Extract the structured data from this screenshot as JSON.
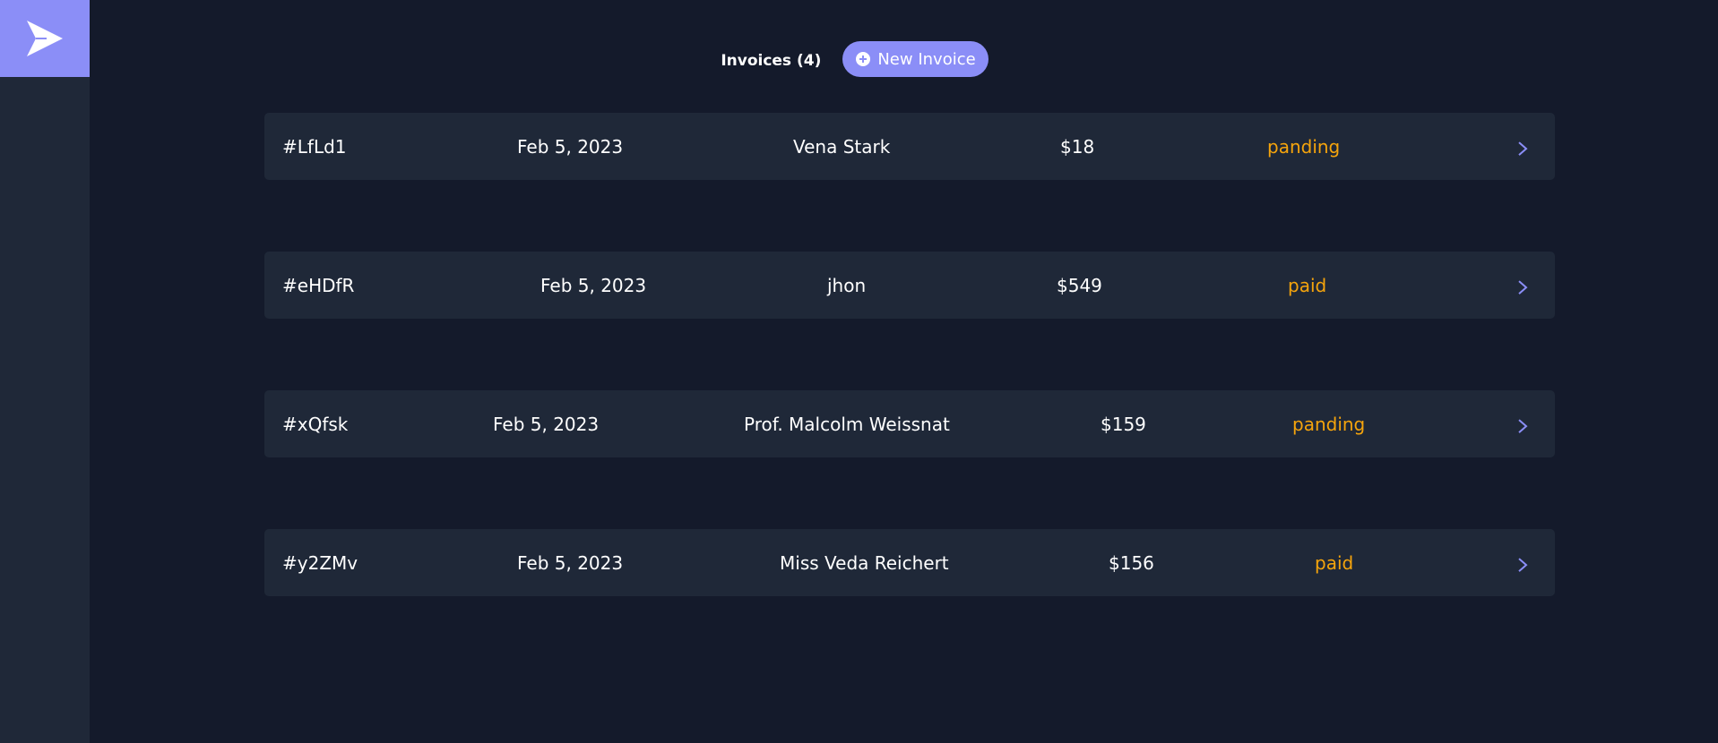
{
  "sidebar": {
    "logo_icon": "paper-plane-icon",
    "colors": {
      "logo_bg": "#8b8ef7",
      "sidebar_bg": "#1f2838"
    }
  },
  "header": {
    "title": "Invoices (4)",
    "new_invoice_label": "New Invoice",
    "new_invoice_icon": "plus-circle-icon"
  },
  "invoices": [
    {
      "id": "#LfLd1",
      "date": "Feb 5, 2023",
      "client": "Vena Stark",
      "amount": "$18",
      "status": "panding"
    },
    {
      "id": "#eHDfR",
      "date": "Feb 5, 2023",
      "client": "jhon",
      "amount": "$549",
      "status": "paid"
    },
    {
      "id": "#xQfsk",
      "date": "Feb 5, 2023",
      "client": "Prof. Malcolm Weissnat",
      "amount": "$159",
      "status": "panding"
    },
    {
      "id": "#y2ZMv",
      "date": "Feb 5, 2023",
      "client": "Miss Veda Reichert",
      "amount": "$156",
      "status": "paid"
    }
  ],
  "colors": {
    "background": "#141a2b",
    "row_bg": "#1f2838",
    "accent": "#8b8ef7",
    "status": "#f5a40c"
  }
}
